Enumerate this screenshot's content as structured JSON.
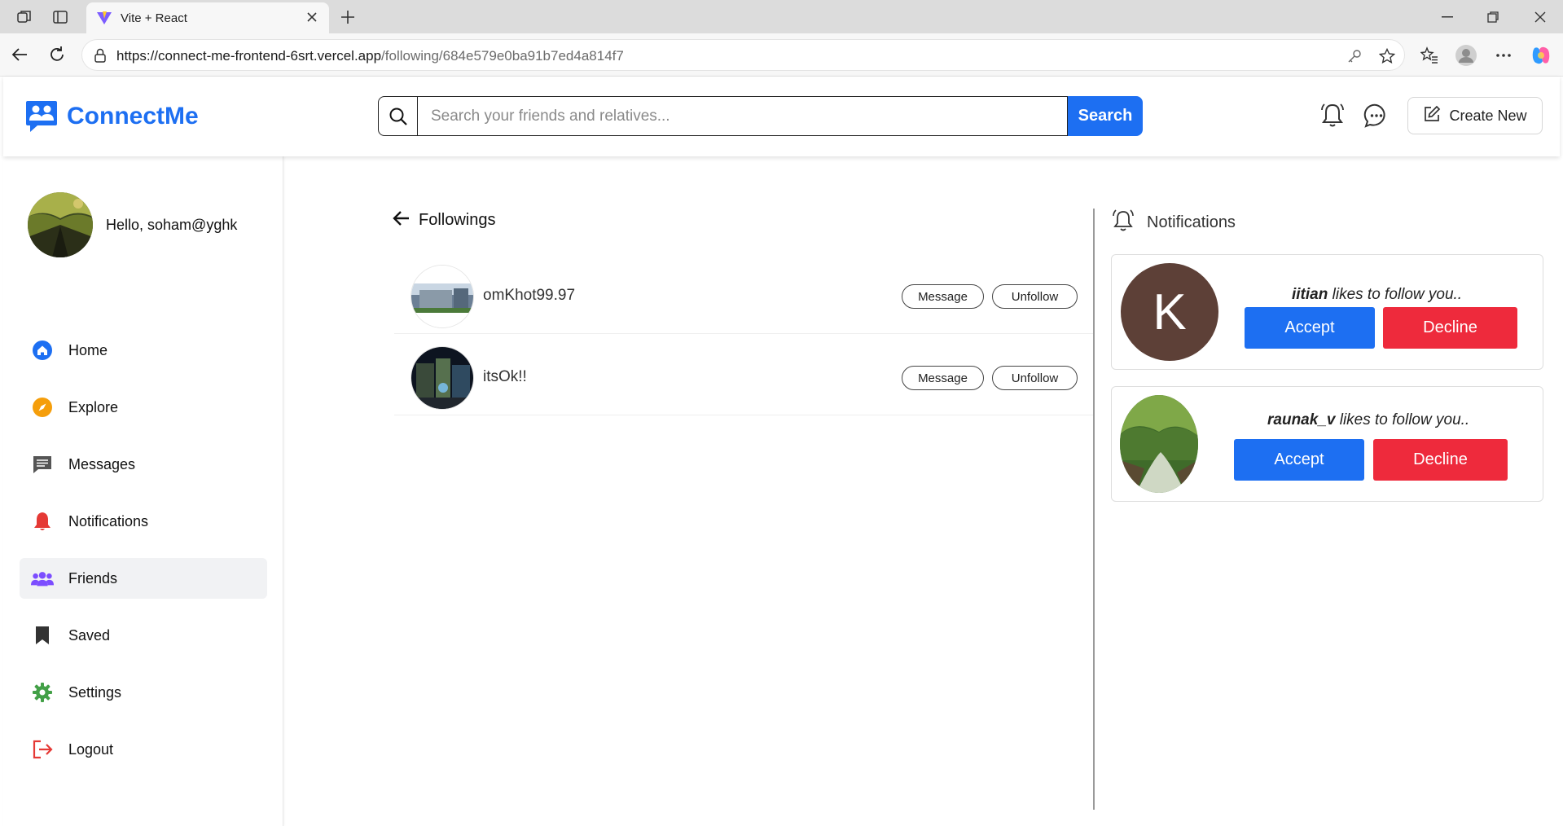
{
  "browser": {
    "tab_title": "Vite + React",
    "url_host": "https://connect-me-frontend-6srt.vercel.app",
    "url_path": "/following/684e579e0ba91b7ed4a814f7"
  },
  "header": {
    "brand": "ConnectMe",
    "search_placeholder": "Search your friends and relatives...",
    "search_button": "Search",
    "create_button": "Create New"
  },
  "sidebar": {
    "greeting": "Hello, soham@yghk",
    "items": [
      {
        "label": "Home",
        "icon": "home-icon",
        "color": "#1d6ff2"
      },
      {
        "label": "Explore",
        "icon": "compass-icon",
        "color": "#f59e0b"
      },
      {
        "label": "Messages",
        "icon": "message-icon",
        "color": "#555555"
      },
      {
        "label": "Notifications",
        "icon": "bell-icon",
        "color": "#e53935"
      },
      {
        "label": "Friends",
        "icon": "users-icon",
        "color": "#7c4dff",
        "active": true
      },
      {
        "label": "Saved",
        "icon": "bookmark-icon",
        "color": "#333333"
      },
      {
        "label": "Settings",
        "icon": "gear-icon",
        "color": "#43a047"
      },
      {
        "label": "Logout",
        "icon": "logout-icon",
        "color": "#e53935"
      }
    ]
  },
  "main": {
    "title": "Followings",
    "followings": [
      {
        "username": "omKhot99.97",
        "message_label": "Message",
        "unfollow_label": "Unfollow"
      },
      {
        "username": "itsOk!!",
        "message_label": "Message",
        "unfollow_label": "Unfollow"
      }
    ]
  },
  "notifications": {
    "title": "Notifications",
    "items": [
      {
        "user": "iitian",
        "text": " likes to follow you..",
        "avatar_letter": "K",
        "accept_label": "Accept",
        "decline_label": "Decline"
      },
      {
        "user": "raunak_v",
        "text": " likes to follow you..",
        "accept_label": "Accept",
        "decline_label": "Decline"
      }
    ]
  },
  "colors": {
    "brand": "#1d6ff2",
    "decline": "#ee2a3c"
  }
}
